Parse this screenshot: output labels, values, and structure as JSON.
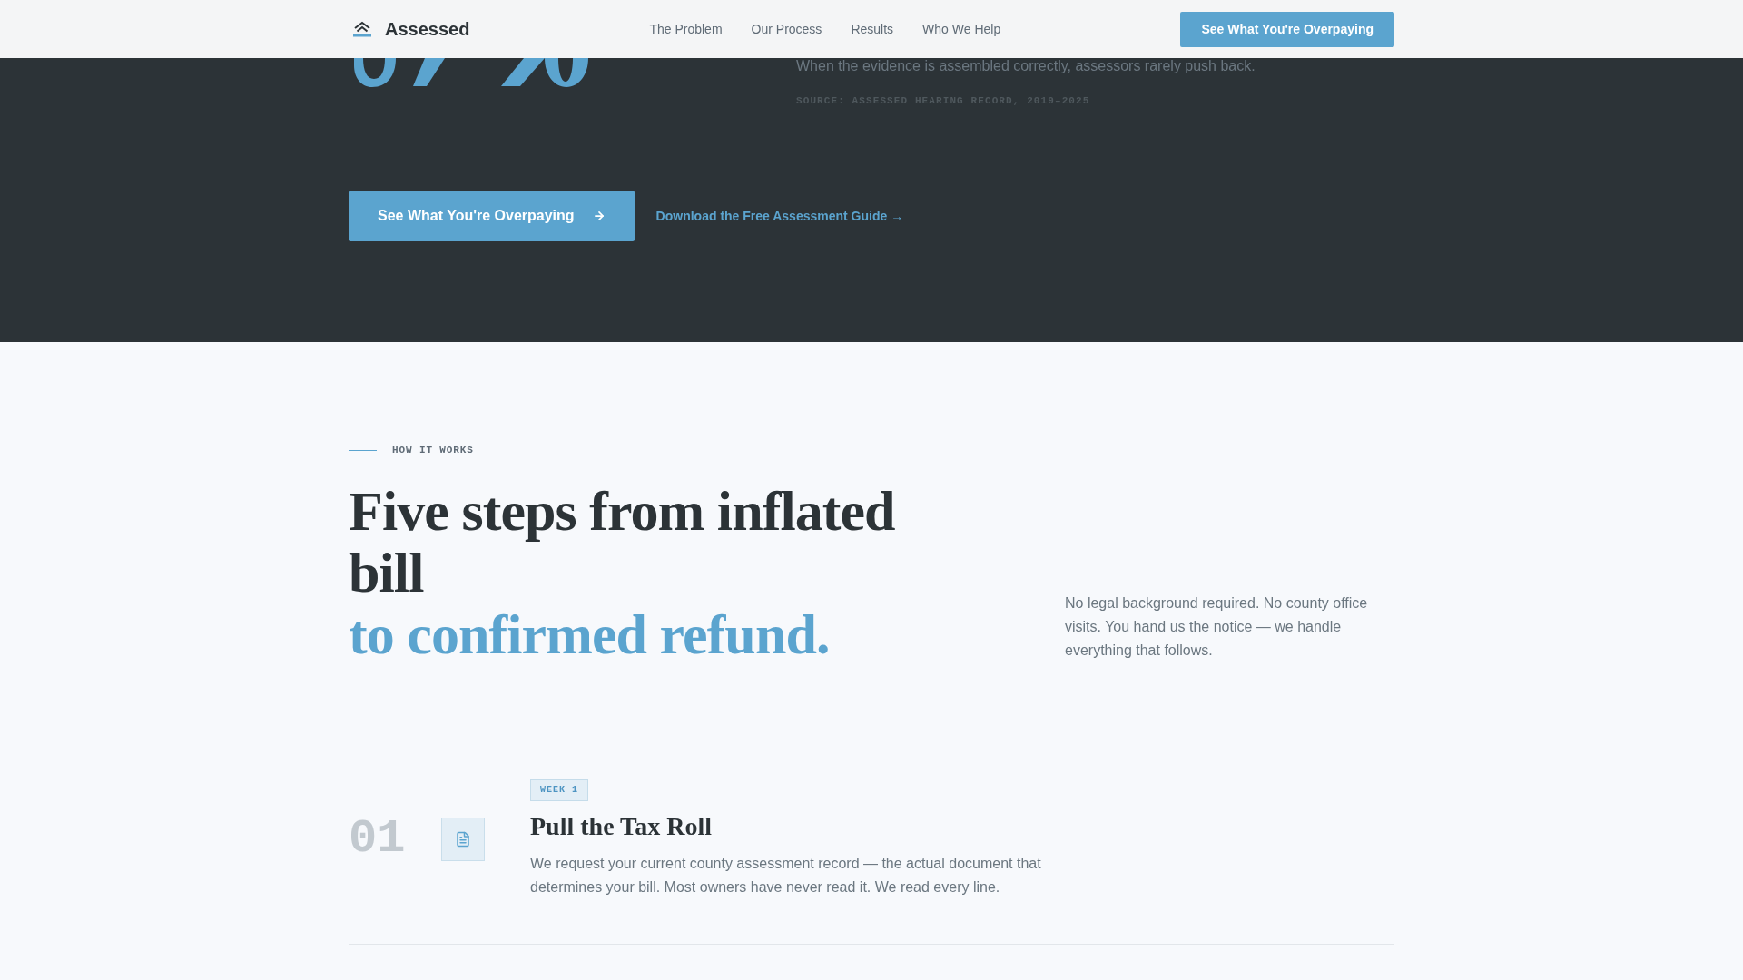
{
  "nav": {
    "brand": "Assessed",
    "links": [
      {
        "label": "The Problem"
      },
      {
        "label": "Our Process"
      },
      {
        "label": "Results"
      },
      {
        "label": "Who We Help"
      }
    ],
    "cta": "See What You're Overpaying"
  },
  "hero": {
    "note": "When the evidence is assembled correctly, assessors rarely push back.",
    "source": "SOURCE: ASSESSED HEARING RECORD, 2019–2025",
    "primary_button": "See What You're Overpaying",
    "guide_link": "Download the Free Assessment Guide →"
  },
  "how_it_works": {
    "eyebrow": "HOW IT WORKS",
    "heading": "Five steps from inflated bill",
    "heading_accent": "to confirmed refund.",
    "intro": "No legal background required. No county office visits. You hand us the notice — we handle everything that follows.",
    "steps": [
      {
        "number": "01",
        "badge": "WEEK 1",
        "title": "Pull the Tax Roll",
        "text": "We request your current county assessment record — the actual document that determines your bill. Most owners have never read it. We read every line."
      }
    ]
  }
}
